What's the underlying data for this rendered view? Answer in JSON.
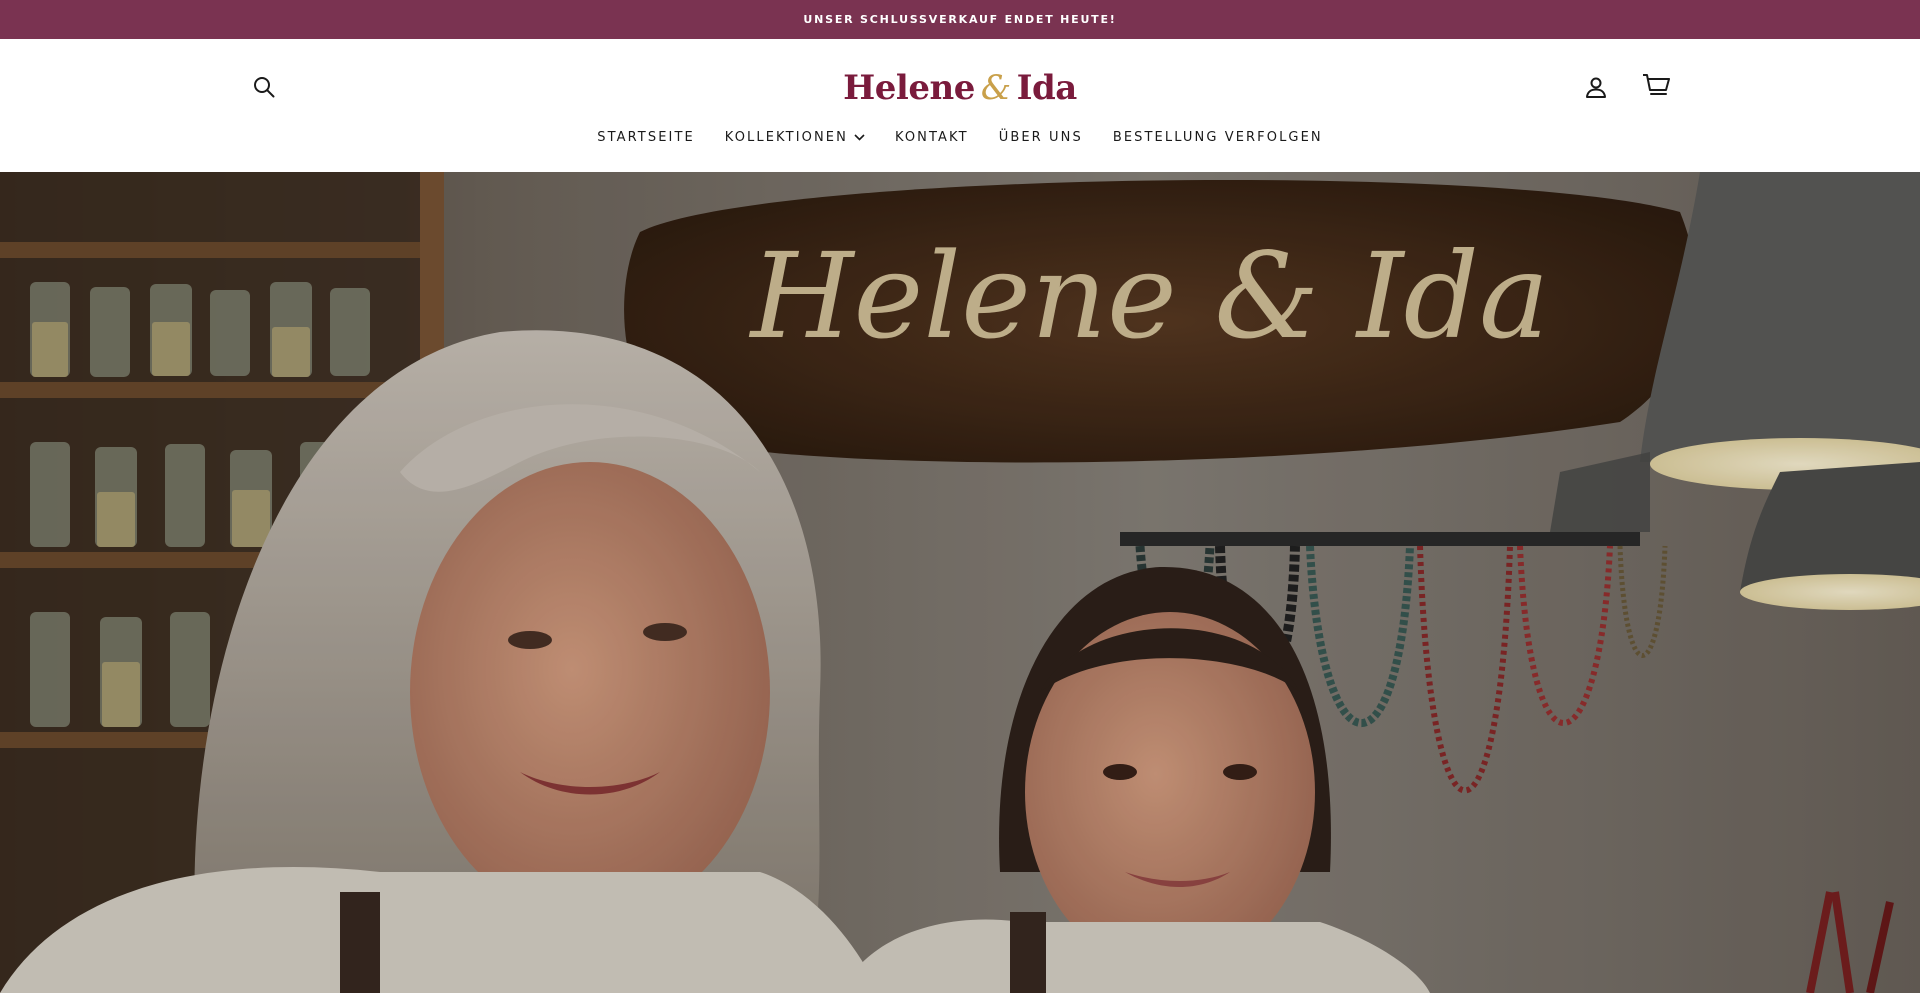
{
  "colors": {
    "announcement_bg": "#7a3351",
    "brand_primary": "#7a1b3c",
    "brand_accent": "#c9a04a",
    "text": "#1a1a1a"
  },
  "announcement": {
    "text": "UNSER SCHLUSSVERKAUF ENDET HEUTE!"
  },
  "header": {
    "logo": {
      "part1": "Helene",
      "amp": "&",
      "part2": "Ida"
    },
    "icons": {
      "search": "search-icon",
      "account": "user-icon",
      "cart": "cart-icon"
    }
  },
  "nav": {
    "items": [
      {
        "label": "STARTSEITE"
      },
      {
        "label": "KOLLEKTIONEN",
        "has_dropdown": true
      },
      {
        "label": "KONTAKT"
      },
      {
        "label": "ÜBER UNS"
      },
      {
        "label": "BESTELLUNG VERFOLGEN"
      }
    ]
  },
  "hero": {
    "sign_text": "Helene & Ida"
  }
}
